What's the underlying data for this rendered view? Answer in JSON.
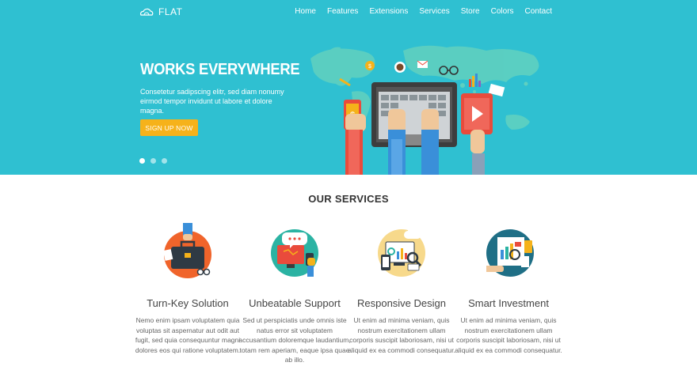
{
  "header": {
    "logo_text": "FLAT",
    "nav": [
      "Home",
      "Features",
      "Extensions",
      "Services",
      "Store",
      "Colors",
      "Contact"
    ]
  },
  "hero": {
    "title": "WORKS EVERYWHERE",
    "text": "Consetetur sadipscing elitr, sed diam nonumy eirmod tempor invidunt ut labore et dolore magna.",
    "cta_label": "SIGN UP NOW",
    "slides": 3,
    "active_slide": 1
  },
  "services": {
    "title": "OUR SERVICES",
    "items": [
      {
        "title": "Turn-Key Solution",
        "text": "Nemo enim ipsam voluptatem quia voluptas sit aspernatur aut odit aut fugit, sed quia consequuntur magni dolores eos qui ratione voluptatem.",
        "icon": "briefcase-icon"
      },
      {
        "title": "Unbeatable Support",
        "text": "Sed ut perspiciatis unde omnis iste natus error sit voluptatem accusantium doloremque laudantium, totam rem aperiam, eaque ipsa quae ab illo.",
        "icon": "support-icon"
      },
      {
        "title": "Responsive Design",
        "text": "Ut enim ad minima veniam, quis nostrum exercitationem ullam corporis suscipit laboriosam, nisi ut aliquid ex ea commodi consequatur.",
        "icon": "responsive-icon"
      },
      {
        "title": "Smart Investment",
        "text": "Ut enim ad minima veniam, quis nostrum exercitationem ullam corporis suscipit laboriosam, nisi ut aliquid ex ea commodi consequatur.",
        "icon": "investment-icon"
      }
    ]
  },
  "colors": {
    "hero_bg": "#2fc0d1",
    "cta": "#f6b21a"
  }
}
